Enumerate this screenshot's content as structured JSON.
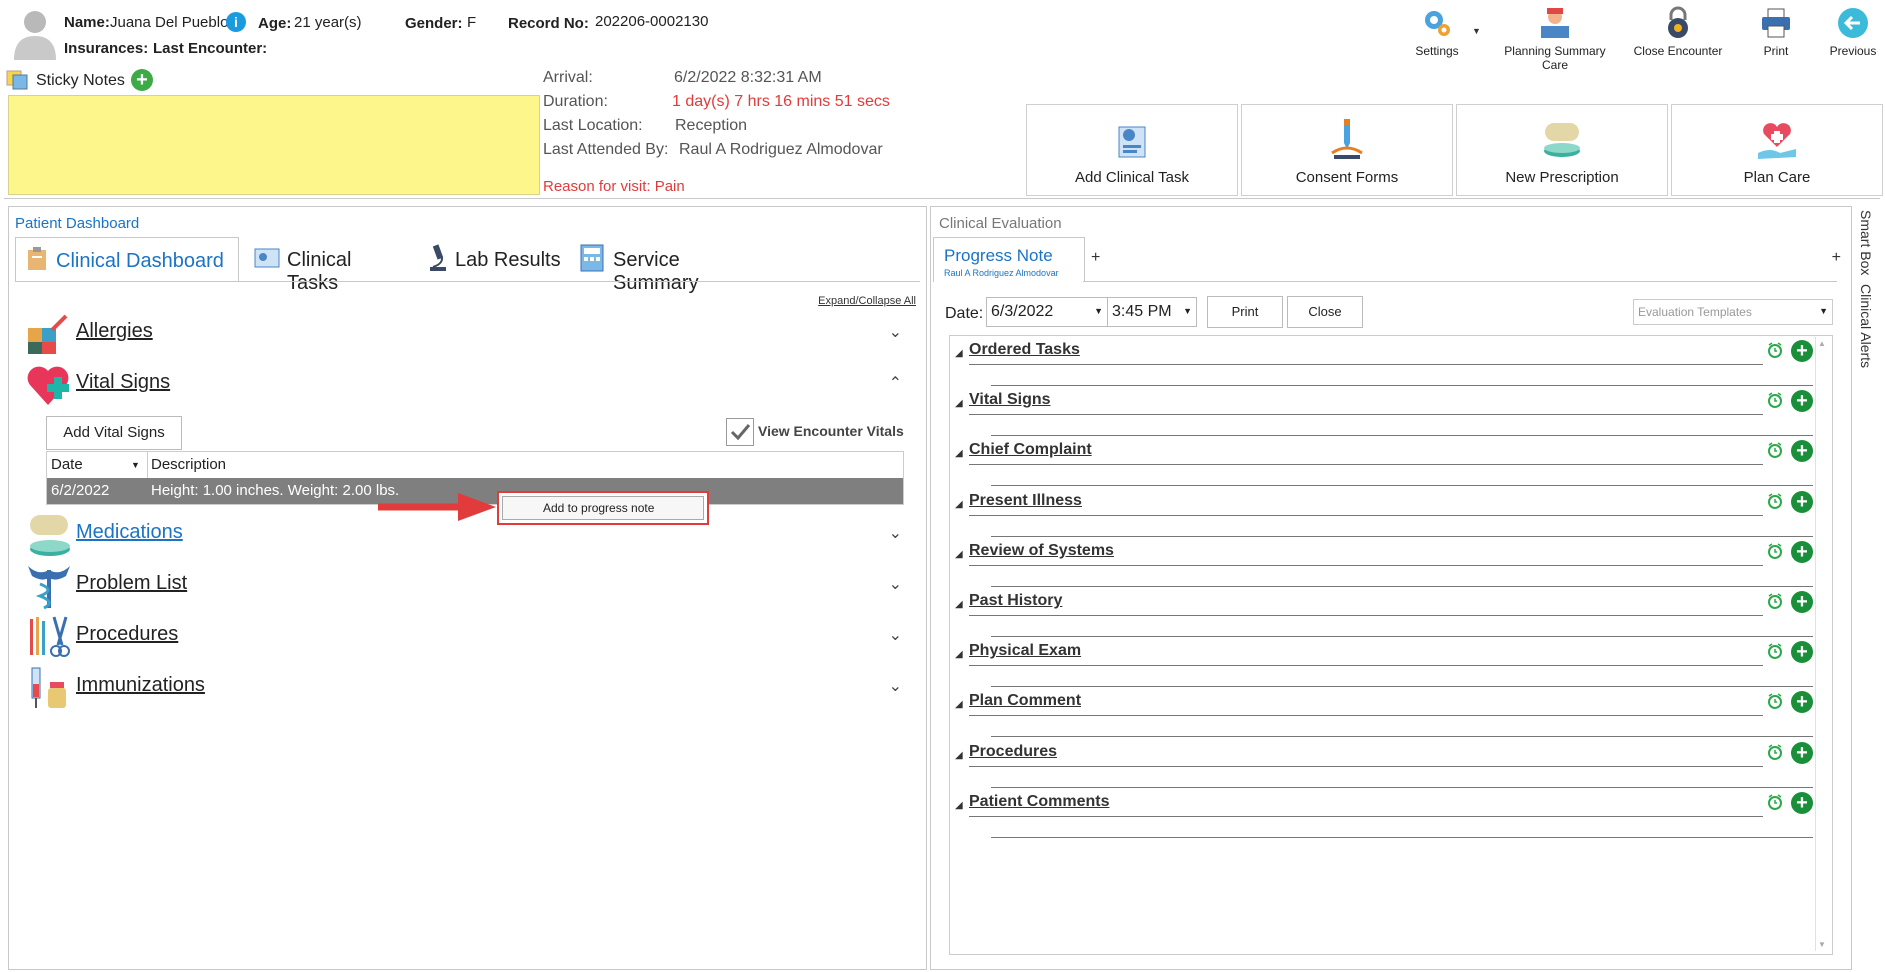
{
  "patient": {
    "name_label": "Name:",
    "name": "Juana Del Pueblo",
    "age_label": "Age:",
    "age": "21 year(s)",
    "gender_label": "Gender:",
    "gender": "F",
    "record_label": "Record No:",
    "record": "202206-0002130",
    "insurances_label": "Insurances:",
    "last_encounter_label": "Last Encounter:"
  },
  "sticky": {
    "label": "Sticky Notes"
  },
  "encounter": {
    "arrival_label": "Arrival:",
    "arrival": "6/2/2022 8:32:31 AM",
    "duration_label": "Duration:",
    "duration": "1 day(s) 7 hrs 16 mins 51 secs",
    "last_location_label": "Last Location:",
    "last_location": "Reception",
    "last_attended_label": "Last Attended By:",
    "last_attended": "Raul A Rodriguez Almodovar",
    "reason": "Reason for visit: Pain"
  },
  "toolbar": {
    "settings": "Settings",
    "planning": "Planning Summary Care",
    "close_encounter": "Close Encounter",
    "print": "Print",
    "previous": "Previous"
  },
  "actions": {
    "add_task": "Add Clinical Task",
    "consent": "Consent Forms",
    "prescription": "New Prescription",
    "plan_care": "Plan Care"
  },
  "dashboard": {
    "panel_title": "Patient Dashboard",
    "tabs": [
      "Clinical Dashboard",
      "Clinical Tasks",
      "Lab Results",
      "Service Summary"
    ],
    "expand": "Expand/Collapse All",
    "sections": [
      "Allergies",
      "Vital Signs",
      "Medications",
      "Problem List",
      "Procedures",
      "Immunizations"
    ],
    "add_vitals": "Add Vital Signs",
    "view_vitals": "View Encounter Vitals",
    "table": {
      "headers": [
        "Date",
        "Description"
      ],
      "rows": [
        {
          "date": "6/2/2022",
          "desc": "Height: 1.00 inches. Weight: 2.00 lbs."
        }
      ]
    },
    "context_menu": "Add to progress note"
  },
  "evaluation": {
    "panel_title": "Clinical Evaluation",
    "tab": "Progress Note",
    "tab_sub": "Raul A Rodriguez Almodovar",
    "add": "+",
    "date_label": "Date:",
    "date": "6/3/2022",
    "time": "3:45 PM",
    "print": "Print",
    "close": "Close",
    "templates": "Evaluation Templates",
    "rows": [
      "Ordered Tasks",
      "Vital Signs",
      "Chief Complaint",
      "Present Illness",
      "Review of Systems",
      "Past History",
      "Physical Exam",
      "Plan Comment",
      "Procedures",
      "Patient Comments"
    ]
  },
  "side": {
    "smart_box": "Smart Box",
    "alerts": "Clinical Alerts"
  },
  "colors": {
    "accent": "#1a73c7",
    "danger": "#e23b3b",
    "sticky": "#fdf68a",
    "green": "#1a8f3a"
  }
}
